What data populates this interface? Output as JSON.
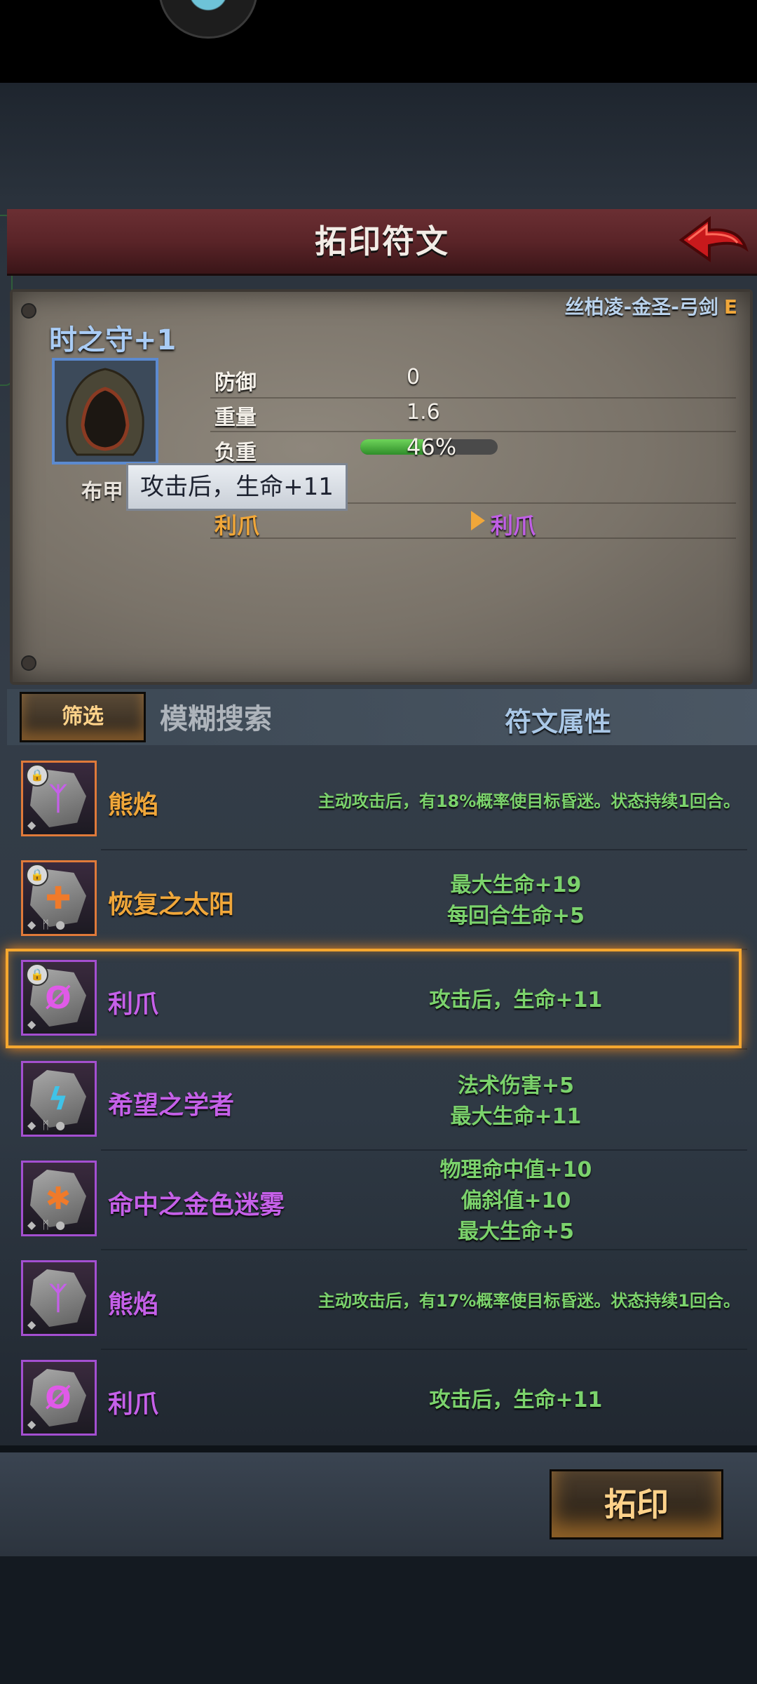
{
  "header": {
    "title": "拓印符文",
    "back_icon": "red-arrow-back-icon"
  },
  "item": {
    "owner": "丝柏凌-金圣-弓剑",
    "grade": "E",
    "name": "时之守+1",
    "type": "布甲",
    "stats": [
      {
        "label": "防御",
        "value": "0"
      },
      {
        "label": "重量",
        "value": "1.6"
      },
      {
        "label": "负重",
        "value": "46%"
      }
    ],
    "load_fraction": 0.46,
    "current_rune": "利爪",
    "new_rune": "利爪",
    "tooltip": "攻击后，生命+11"
  },
  "filter": {
    "button": "筛选",
    "search_placeholder": "模糊搜索",
    "attr_header": "符文属性"
  },
  "runes": [
    {
      "name": "熊焰",
      "color": "#f0a73a",
      "frame": "#e07a3a",
      "glyph": "ᛉ",
      "glyph_color": "#c560e8",
      "locked": true,
      "slots": "◆",
      "attrs": [
        "主动攻击后，有18%概率使目标昏迷。状态持续1回合。"
      ],
      "small": true
    },
    {
      "name": "恢复之太阳",
      "color": "#f0a73a",
      "frame": "#e07a3a",
      "glyph": "✚",
      "glyph_color": "#f07a2a",
      "locked": true,
      "slots": "◆ ᛗ ●",
      "attrs": [
        "最大生命+19",
        "每回合生命+5"
      ],
      "small": false
    },
    {
      "name": "利爪",
      "color": "#c560e8",
      "frame": "#a44fd1",
      "glyph": "Ø",
      "glyph_color": "#e05ae8",
      "locked": true,
      "slots": "◆",
      "attrs": [
        "攻击后，生命+11"
      ],
      "small": false
    },
    {
      "name": "希望之学者",
      "color": "#c560e8",
      "frame": "#a44fd1",
      "glyph": "ϟ",
      "glyph_color": "#3fc3e8",
      "locked": false,
      "slots": "◆ ᛗ ●",
      "attrs": [
        "法术伤害+5",
        "最大生命+11"
      ],
      "small": false
    },
    {
      "name": "命中之金色迷雾",
      "color": "#c560e8",
      "frame": "#a44fd1",
      "glyph": "✱",
      "glyph_color": "#f07a2a",
      "locked": false,
      "slots": "◆ ᛗ ●",
      "attrs": [
        "物理命中值+10",
        "偏斜值+10",
        "最大生命+5"
      ],
      "small": false
    },
    {
      "name": "熊焰",
      "color": "#c560e8",
      "frame": "#a44fd1",
      "glyph": "ᛉ",
      "glyph_color": "#c560e8",
      "locked": false,
      "slots": "◆",
      "attrs": [
        "主动攻击后，有17%概率使目标昏迷。状态持续1回合。"
      ],
      "small": true
    },
    {
      "name": "利爪",
      "color": "#c560e8",
      "frame": "#a44fd1",
      "glyph": "Ø",
      "glyph_color": "#e05ae8",
      "locked": false,
      "slots": "◆",
      "attrs": [
        "攻击后，生命+11"
      ],
      "small": false
    }
  ],
  "selected_index": 2,
  "footer": {
    "print_button": "拓印"
  }
}
